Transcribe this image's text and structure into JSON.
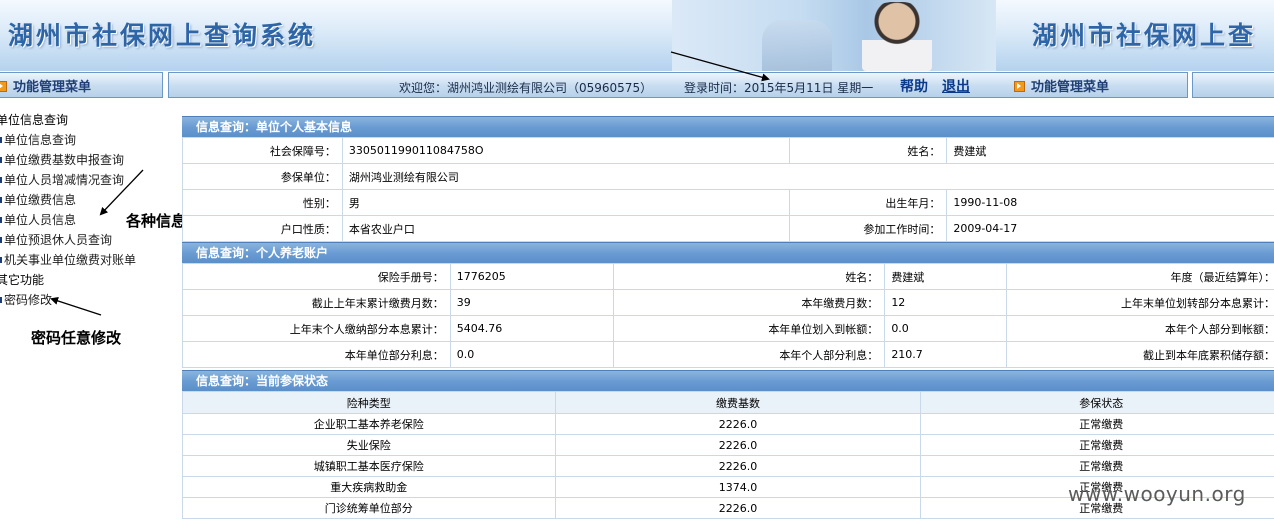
{
  "header": {
    "title": "湖州市社保网上查询系统",
    "title_repeat": "湖州市社保网上查"
  },
  "menubar": {
    "left_title": "功能管理菜单",
    "right_title": "功能管理菜单",
    "welcome": "欢迎您：湖州鸿业测绘有限公司（05960575）",
    "login_time": "登录时间：2015年5月11日 星期一",
    "help": "帮助",
    "logout": "退出"
  },
  "sidebar": {
    "items": [
      {
        "label": "单位信息查询",
        "marker": false
      },
      {
        "label": "单位信息查询",
        "marker": true
      },
      {
        "label": "单位缴费基数申报查询",
        "marker": true
      },
      {
        "label": "单位人员增减情况查询",
        "marker": true
      },
      {
        "label": "单位缴费信息",
        "marker": true
      },
      {
        "label": "单位人员信息",
        "marker": true
      },
      {
        "label": "单位预退休人员查询",
        "marker": true
      },
      {
        "label": "机关事业单位缴费对账单",
        "marker": true
      },
      {
        "label": "其它功能",
        "marker": false
      },
      {
        "label": "密码修改",
        "marker": true
      }
    ]
  },
  "annotations": {
    "info_note": "各种信息",
    "password_note": "密码任意修改"
  },
  "panel_basic": {
    "title": "信息查询：单位个人基本信息",
    "ssn_label": "社会保障号：",
    "ssn": "330501199011084758O",
    "name_label": "姓名：",
    "name": "费建斌",
    "employer_label": "参保单位：",
    "employer": "湖州鸿业测绘有限公司",
    "gender_label": "性别：",
    "gender": "男",
    "birth_label": "出生年月：",
    "birth": "1990-11-08",
    "hukou_label": "户口性质：",
    "hukou": "本省农业户口",
    "work_start_label": "参加工作时间：",
    "work_start": "2009-04-17"
  },
  "panel_pension": {
    "title": "信息查询：个人养老账户",
    "book_no_label": "保险手册号：",
    "book_no": "1776205",
    "name_label": "姓名：",
    "name": "费建斌",
    "year_label": "年度（最近结算年）：",
    "months_label": "截止上年末累计缴费月数：",
    "months": "39",
    "year_months_label": "本年缴费月数：",
    "year_months": "12",
    "unit_interest_cum_label": "上年末单位划转部分本息累计：",
    "personal_cum_label": "上年末个人缴纳部分本息累计：",
    "personal_cum": "5404.76",
    "unit_transfer_label": "本年单位划入到帐额：",
    "unit_transfer": "0.0",
    "personal_arrival_label": "本年个人部分到帐额：",
    "unit_interest_label": "本年单位部分利息：",
    "unit_interest": "0.0",
    "personal_interest_label": "本年个人部分利息：",
    "personal_interest": "210.7",
    "balance_label": "截止到本年底累积储存额："
  },
  "panel_status": {
    "title": "信息查询：当前参保状态",
    "headers": [
      "险种类型",
      "缴费基数",
      "参保状态"
    ],
    "rows": [
      [
        "企业职工基本养老保险",
        "2226.0",
        "正常缴费"
      ],
      [
        "失业保险",
        "2226.0",
        "正常缴费"
      ],
      [
        "城镇职工基本医疗保险",
        "2226.0",
        "正常缴费"
      ],
      [
        "重大疾病救助金",
        "1374.0",
        "正常缴费"
      ],
      [
        "门诊统筹单位部分",
        "2226.0",
        "正常缴费"
      ]
    ]
  },
  "watermark": "www.wooyun.org"
}
